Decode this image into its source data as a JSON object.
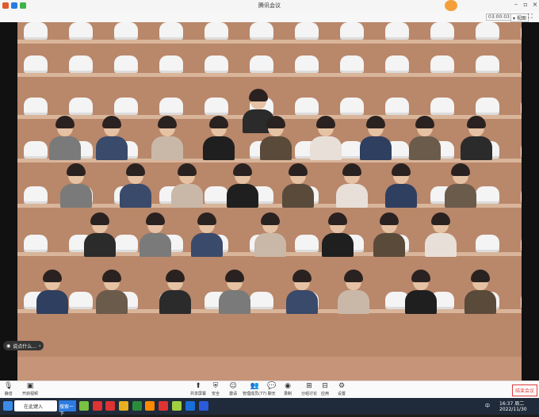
{
  "window": {
    "title": "腾讯会议",
    "min": "–",
    "max": "▫",
    "close": "×"
  },
  "header": {
    "timer": "03:00:03",
    "view_label": "视图",
    "fullscreen_icon": "fullscreen-icon"
  },
  "chat_hint": {
    "text": "说点什么...",
    "collapse": "‹"
  },
  "toolbar": {
    "mute": "静音",
    "video": "开启视频",
    "share": "共享屏幕",
    "security": "安全",
    "invite": "邀请",
    "members": "管理成员(77)",
    "chat": "聊天",
    "record": "录制",
    "breakout": "分组讨论",
    "apps": "应用",
    "settings": "设置",
    "end": "结束会议"
  },
  "taskbar": {
    "search": "在此键入",
    "app_label": "搜索一下",
    "time": "16:37 周二",
    "date": "2022/11/30",
    "ime": "中"
  },
  "colors": {
    "wall": "#b9876a",
    "seat": "#f4f4f4",
    "taskbar": "#1f2a3a",
    "end": "#e03a3a"
  }
}
